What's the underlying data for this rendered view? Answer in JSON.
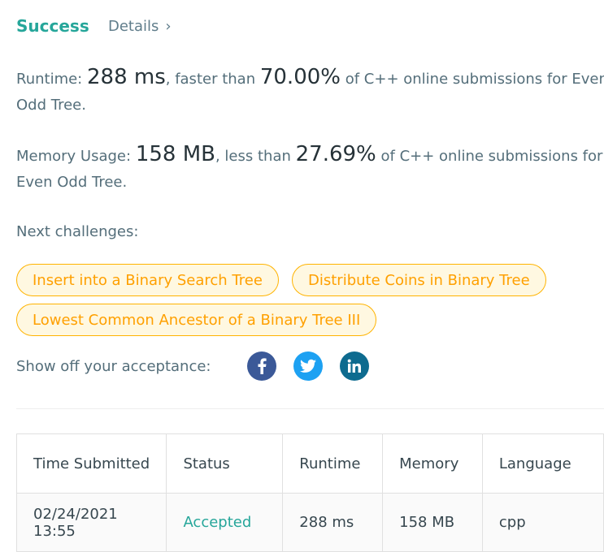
{
  "header": {
    "status": "Success",
    "details_label": "Details",
    "details_chevron": "›"
  },
  "runtime": {
    "label": "Runtime:",
    "value": "288 ms",
    "mid": ", faster than",
    "percent": "70.00%",
    "rest": "of C++ online submissions for Even",
    "line2": "Odd Tree."
  },
  "memory": {
    "label": "Memory Usage:",
    "value": "158 MB",
    "mid": ", less than",
    "percent": "27.69%",
    "rest": "of C++ online submissions for",
    "line2": "Even Odd Tree."
  },
  "next": {
    "label": "Next challenges:",
    "items": [
      "Insert into a Binary Search Tree",
      "Distribute Coins in Binary Tree",
      "Lowest Common Ancestor of a Binary Tree III"
    ]
  },
  "share": {
    "label": "Show off your acceptance:",
    "icons": [
      {
        "name": "facebook-icon",
        "glyph": "f",
        "color": "#3b5998"
      },
      {
        "name": "twitter-icon",
        "glyph": "t",
        "color": "#1da1f2"
      },
      {
        "name": "linkedin-icon",
        "glyph": "in",
        "color": "#0e6b8f"
      }
    ]
  },
  "table": {
    "headers": [
      "Time Submitted",
      "Status",
      "Runtime",
      "Memory",
      "Language"
    ],
    "row": [
      "02/24/2021 13:55",
      "Accepted",
      "288 ms",
      "158 MB",
      "cpp"
    ]
  }
}
